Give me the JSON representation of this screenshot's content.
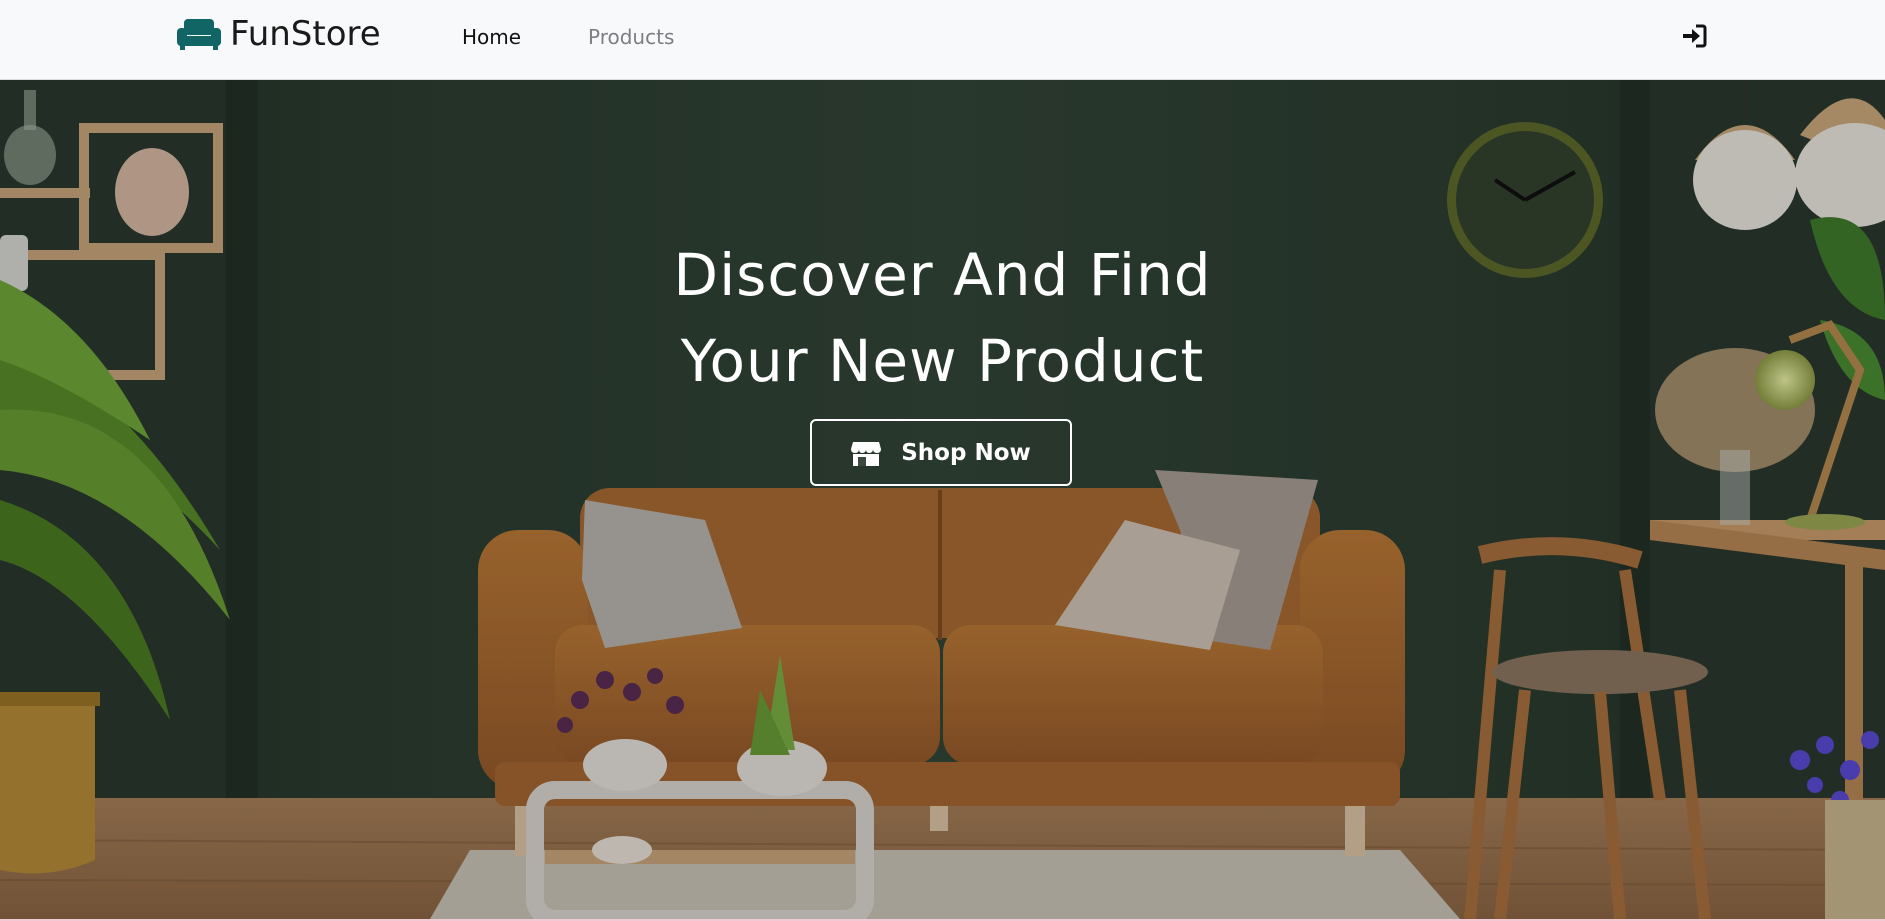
{
  "navbar": {
    "brand_name": "FunStore",
    "brand_icon": "couch-icon",
    "links": [
      {
        "label": "Home",
        "active": true
      },
      {
        "label": "Products",
        "active": false
      }
    ],
    "login_icon": "sign-in-icon"
  },
  "hero": {
    "title_line1": "Discover And Find",
    "title_line2": "Your New Product",
    "cta_label": "Shop Now",
    "cta_icon": "store-icon",
    "background_description": "living room with leather sofa"
  },
  "colors": {
    "brand_icon": "#126565",
    "navbar_bg": "#f8f9fa",
    "wall": "#2c3d31",
    "sofa": "#b06d2f"
  }
}
